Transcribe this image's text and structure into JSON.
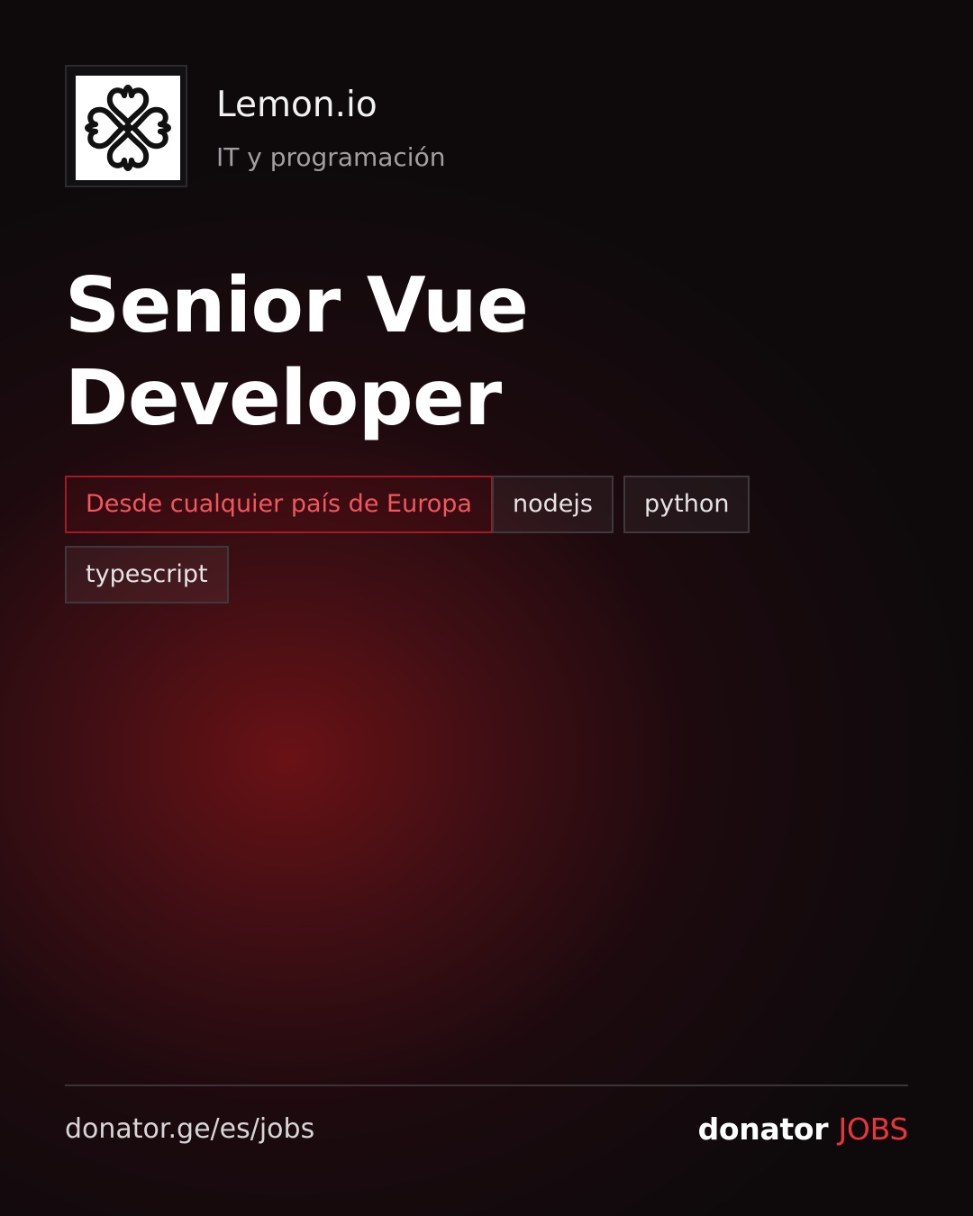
{
  "company": {
    "name": "Lemon.io",
    "category": "IT y programación",
    "logo_icon": "lemon-io-knot-logo"
  },
  "job": {
    "title_line1": "Senior Vue",
    "title_line2": "Developer"
  },
  "tags": {
    "location": "Desde cualquier país de Europa",
    "skills": [
      "nodejs",
      "python",
      "typescript"
    ]
  },
  "footer": {
    "url": "donator.ge/es/jobs",
    "brand_word": "donator",
    "brand_jobs": "JOBS"
  },
  "colors": {
    "accent": "#e8363d",
    "location_tag_text": "#f0575e",
    "background": "#0e0a0c",
    "glow": "#6e1216"
  }
}
